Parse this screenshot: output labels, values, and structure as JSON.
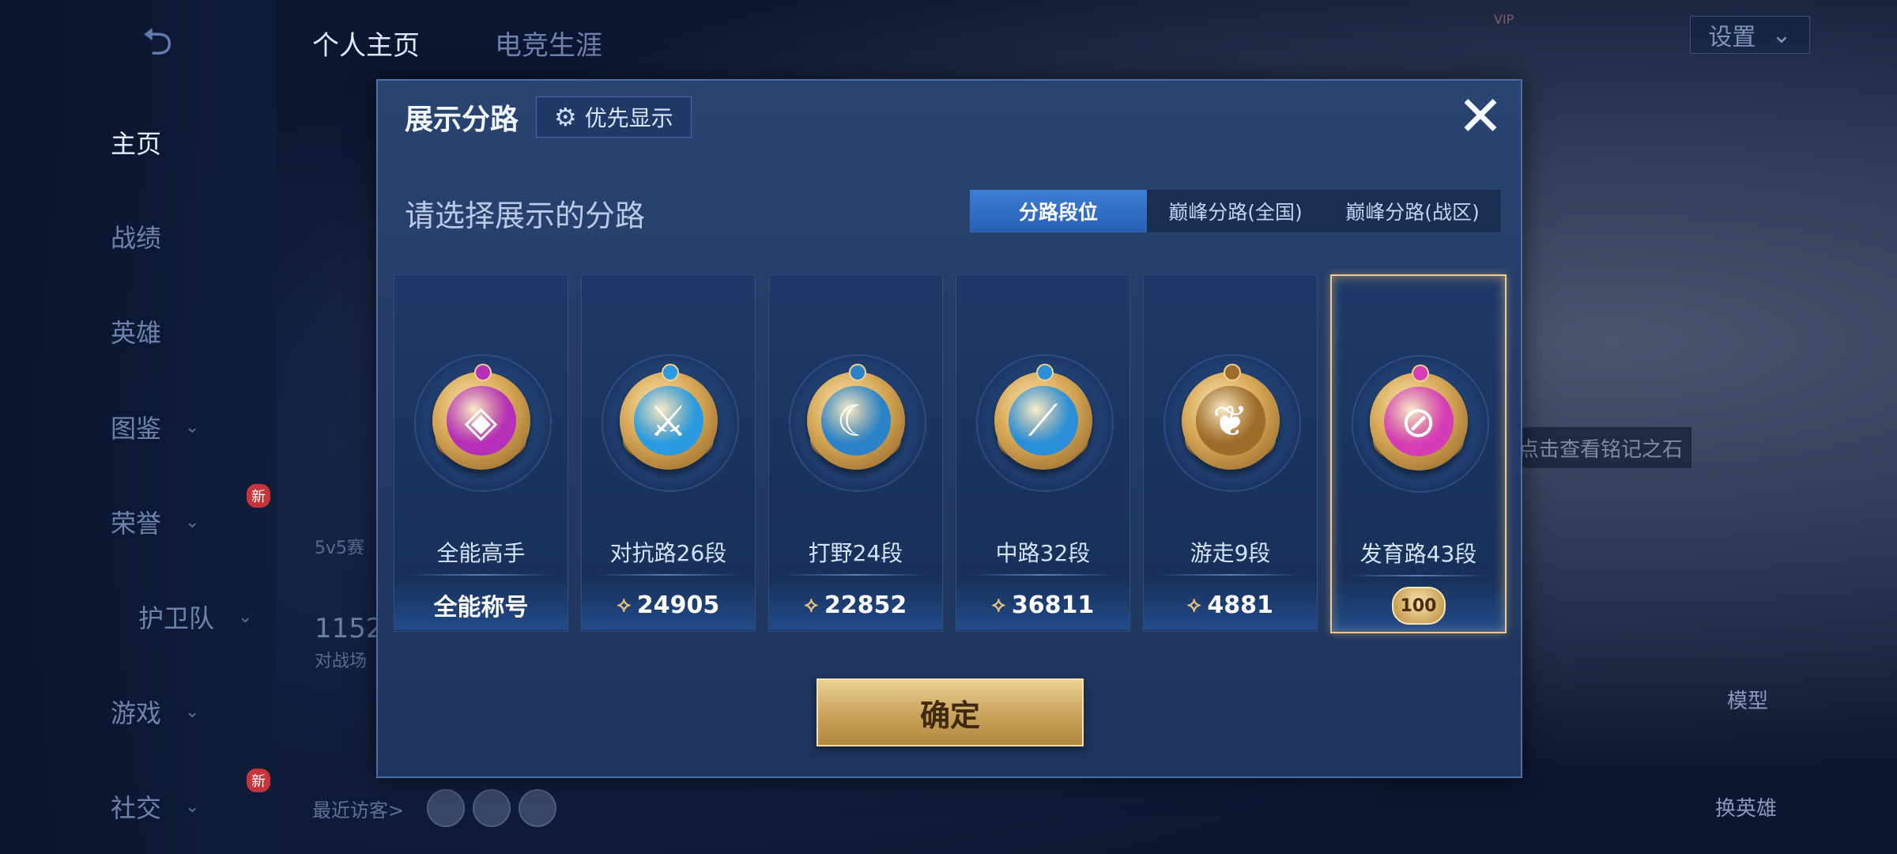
{
  "nav": {
    "tabs": [
      "个人主页",
      "电竞生涯"
    ],
    "settings_label": "设置",
    "items": [
      {
        "label": "主页"
      },
      {
        "label": "战绩"
      },
      {
        "label": "英雄"
      },
      {
        "label": "图鉴"
      },
      {
        "label": "荣誉",
        "badge": "新"
      },
      {
        "label": "护卫队"
      },
      {
        "label": "游戏"
      },
      {
        "label": "社交",
        "badge": "新"
      }
    ]
  },
  "background": {
    "mode_label": "5v5赛",
    "match_count": "1152",
    "match_sub": "对战场",
    "recent_visitors_label": "最近访客>",
    "inscription_hint": "点击查看铭记之石",
    "model_label": "模型",
    "swap_hero_label": "换英雄"
  },
  "modal": {
    "title": "展示分路",
    "pref_button": "优先显示",
    "close_icon": "close-icon",
    "subtitle": "请选择展示的分路",
    "segments": [
      "分路段位",
      "巅峰分路(全国)",
      "巅峰分路(战区)"
    ],
    "active_segment": 0,
    "cards": [
      {
        "label": "全能高手",
        "footer": "全能称号",
        "core_color": "#b52fb8",
        "symbol": "◈",
        "selected": false
      },
      {
        "label": "对抗路26段",
        "footer": "24905",
        "core_color": "#2a9be0",
        "symbol": "⚔",
        "selected": false
      },
      {
        "label": "打野24段",
        "footer": "22852",
        "core_color": "#2a83c9",
        "symbol": "☾",
        "selected": false
      },
      {
        "label": "中路32段",
        "footer": "36811",
        "core_color": "#2a8fd8",
        "symbol": "⟋",
        "selected": false
      },
      {
        "label": "游走9段",
        "footer": "4881",
        "core_color": "#9c6c2a",
        "symbol": "❦",
        "selected": false
      },
      {
        "label": "发育路43段",
        "footer": "100",
        "core_color": "#d43db5",
        "symbol": "⊘",
        "selected": true
      }
    ],
    "confirm_button": "确定"
  },
  "colors": {
    "accent": "#3c7ed6",
    "gold": "#c9a25b",
    "selected_border": "#f0c98a"
  }
}
